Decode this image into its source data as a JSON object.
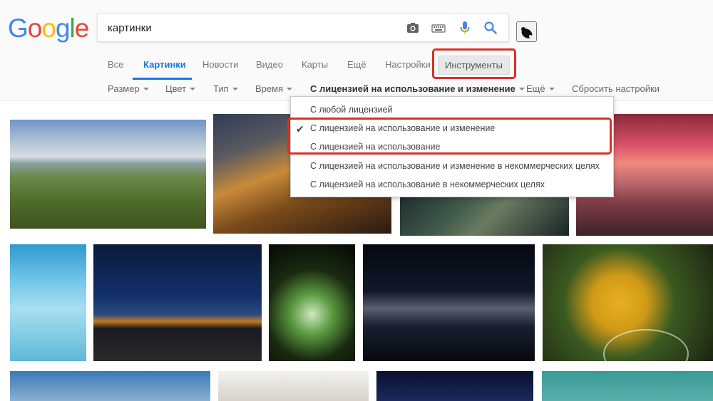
{
  "search": {
    "query": "картинки"
  },
  "logo": {
    "letters": [
      "G",
      "o",
      "o",
      "g",
      "l",
      "e"
    ],
    "colors": [
      "#4285f4",
      "#ea4335",
      "#fbbc05",
      "#4285f4",
      "#34a853",
      "#ea4335"
    ]
  },
  "tabs": [
    {
      "label": "Все"
    },
    {
      "label": "Картинки"
    },
    {
      "label": "Новости"
    },
    {
      "label": "Видео"
    },
    {
      "label": "Карты"
    },
    {
      "label": "Ещё"
    },
    {
      "label": "Настройки"
    }
  ],
  "tools_button": {
    "label": "Инструменты"
  },
  "filters": {
    "size": "Размер",
    "color": "Цвет",
    "type": "Тип",
    "time": "Время",
    "license": "С лицензией на использование и изменение",
    "more": "Ещё",
    "reset": "Сбросить настройки"
  },
  "license_menu": {
    "options": [
      "С любой лицензией",
      "С лицензией на использование и изменение",
      "С лицензией на использование",
      "С лицензией на использование и изменение в некоммерческих целях",
      "С лицензией на использование в некоммерческих целях"
    ],
    "checkmark": "✔"
  },
  "icons": [
    "camera-icon",
    "keyboard-icon",
    "microphone-icon",
    "search-icon"
  ],
  "colors": {
    "accent": "#1a73e8",
    "highlight": "#d93025"
  }
}
